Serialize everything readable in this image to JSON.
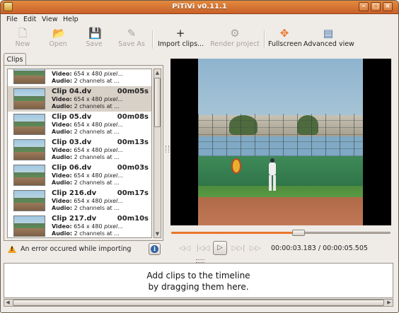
{
  "window": {
    "title": "PiTiVi v0.11.1"
  },
  "menubar": {
    "items": [
      "File",
      "Edit",
      "View",
      "Help"
    ]
  },
  "toolbar": {
    "items": [
      {
        "label": "New",
        "icon": "new-project-icon",
        "enabled": false
      },
      {
        "label": "Open",
        "icon": "open-folder-icon",
        "enabled": false
      },
      {
        "label": "Save",
        "icon": "floppy-disk-icon",
        "enabled": false
      },
      {
        "label": "Save As",
        "icon": "save-as-icon",
        "enabled": false
      },
      {
        "label": "Import clips...",
        "icon": "plus-icon",
        "enabled": true
      },
      {
        "label": "Render project",
        "icon": "render-reel-icon",
        "enabled": false
      },
      {
        "label": "Fullscreen",
        "icon": "fullscreen-arrows-icon",
        "enabled": true
      },
      {
        "label": "Advanced view",
        "icon": "timeline-view-icon",
        "enabled": true
      }
    ]
  },
  "clips_tab": {
    "label": "Clips"
  },
  "clips": [
    {
      "name": "",
      "duration": "",
      "video_label": "Video:",
      "video_value": "654 x 480",
      "video_extra": "pixel...",
      "audio_label": "Audio:",
      "audio_value": "2 channels at ...",
      "selected": false
    },
    {
      "name": "Clip 04.dv",
      "duration": "00m05s",
      "video_label": "Video:",
      "video_value": "654 x 480",
      "video_extra": "pixel...",
      "audio_label": "Audio:",
      "audio_value": "2 channels at ...",
      "selected": true
    },
    {
      "name": "Clip 05.dv",
      "duration": "00m08s",
      "video_label": "Video:",
      "video_value": "654 x 480",
      "video_extra": "pixel...",
      "audio_label": "Audio:",
      "audio_value": "2 channels at ...",
      "selected": false
    },
    {
      "name": "Clip 03.dv",
      "duration": "00m13s",
      "video_label": "Video:",
      "video_value": "654 x 480",
      "video_extra": "pixel...",
      "audio_label": "Audio:",
      "audio_value": "2 channels at ...",
      "selected": false
    },
    {
      "name": "Clip 06.dv",
      "duration": "00m03s",
      "video_label": "Video:",
      "video_value": "654 x 480",
      "video_extra": "pixel...",
      "audio_label": "Audio:",
      "audio_value": "2 channels at ...",
      "selected": false
    },
    {
      "name": "Clip 216.dv",
      "duration": "00m17s",
      "video_label": "Video:",
      "video_value": "654 x 480",
      "video_extra": "pixel...",
      "audio_label": "Audio:",
      "audio_value": "2 channels at ...",
      "selected": false
    },
    {
      "name": "Clip 217.dv",
      "duration": "00m10s",
      "video_label": "Video:",
      "video_value": "654 x 480",
      "video_extra": "pixel...",
      "audio_label": "Audio:",
      "audio_value": "2 channels at ...",
      "selected": false
    }
  ],
  "error_bar": {
    "text": "An error occured while importing",
    "icon": "warning-icon",
    "info_icon": "info-icon"
  },
  "player": {
    "position": "00:00:03.183",
    "separator": "/",
    "duration": "00:00:05.505",
    "progress": 0.58,
    "accent_color": "#e8772a"
  },
  "timeline": {
    "hint_line1": "Add clips to the timeline",
    "hint_line2": "by dragging them here."
  }
}
